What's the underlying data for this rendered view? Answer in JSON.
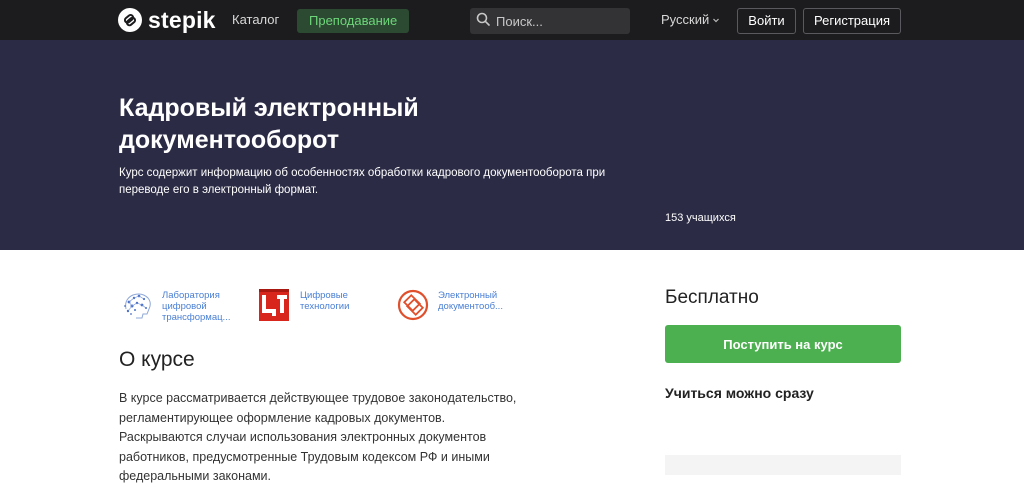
{
  "nav": {
    "logo_text": "stepik",
    "catalog_label": "Каталог",
    "teach_label": "Преподавание",
    "search_placeholder": "Поиск...",
    "language": "Русский",
    "login_label": "Войти",
    "register_label": "Регистрация",
    "teach_accent": "#6ed67a"
  },
  "hero": {
    "title": "Кадровый электронный документооборот",
    "description": "Курс содержит информацию об особенностях обработки кадрового документооборота при переводе его в электронный формат.",
    "learners": "153 учащихся",
    "background": "#2b2b45"
  },
  "authors": [
    {
      "name": "Лаборатория цифровой трансформац...",
      "icon": "brain-network-icon"
    },
    {
      "name": "Цифровые технологии",
      "icon": "cifrovye-tehnologii-logo-icon"
    },
    {
      "name": "Электронный документооб...",
      "icon": "document-circle-icon"
    }
  ],
  "about": {
    "title": "О курсе",
    "text": "В курсе рассматривается действующее трудовое законодательство, регламентирующее оформление кадровых документов. Раскрываются случаи использования электронных документов работников, предусмотренные Трудовым кодексом РФ и иными федеральными законами."
  },
  "sidebar": {
    "price": "Бесплатно",
    "enroll_label": "Поступить на курс",
    "start_now": "Учиться можно сразу",
    "enroll_color": "#4caf50"
  }
}
